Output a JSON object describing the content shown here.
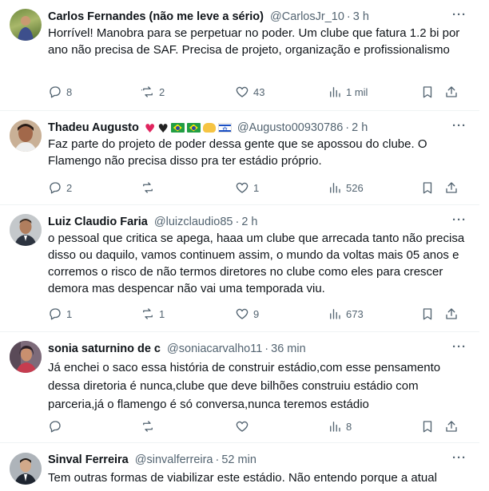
{
  "tweets": [
    {
      "name": "Carlos Fernandes (não me leve a sério)",
      "handle": "@CarlosJr_10",
      "time": "3 h",
      "text": "Horrível! Manobra para se perpetuar no poder. Um clube que fatura 1.2 bi por ano não precisa de SAF. Precisa de projeto, organização e profissionalismo",
      "replies": "8",
      "reposts": "2",
      "likes": "43",
      "views": "1 mil"
    },
    {
      "name": "Thadeu Augusto",
      "handle": "@Augusto00930786",
      "time": "2 h",
      "name_emojis": [
        "red-heart",
        "black-heart",
        "brazil-flag",
        "brazil-flag",
        "handshake",
        "israel-flag"
      ],
      "text": "Faz parte do projeto de poder dessa gente que se apossou do clube. O Flamengo não precisa disso pra ter estádio próprio.",
      "replies": "2",
      "reposts": "",
      "likes": "1",
      "views": "526"
    },
    {
      "name": "Luiz Claudio Faria",
      "handle": "@luizclaudio85",
      "time": "2 h",
      "text": "o pessoal que critica se apega, haaa um clube que arrecada tanto não precisa disso ou daquilo, vamos continuem assim, o mundo da voltas mais 05 anos e corremos o risco de não termos diretores no clube como eles para crescer demora mas despencar não vai uma temporada viu.",
      "replies": "1",
      "reposts": "1",
      "likes": "9",
      "views": "673"
    },
    {
      "name": "sonia saturnino de c",
      "handle": "@soniacarvalho11",
      "time": "36 min",
      "text": "Já enchei o saco essa história de construir estádio,com esse pensamento dessa diretoria é nunca,clube que deve bilhões construiu estádio com parceria,já o flamengo é só conversa,nunca teremos estádio",
      "replies": "",
      "reposts": "",
      "likes": "",
      "views": "8"
    },
    {
      "name": "Sinval Ferreira",
      "handle": "@sinvalferreira",
      "time": "52 min",
      "text": "Tem outras formas de viabilizar este estádio. Não entendo porque a atual"
    }
  ],
  "ui": {
    "separator_dot": "·",
    "more_icon": "···"
  },
  "colors": {
    "text": "#0f1419",
    "secondary": "#536471",
    "divider": "#eff3f4"
  }
}
